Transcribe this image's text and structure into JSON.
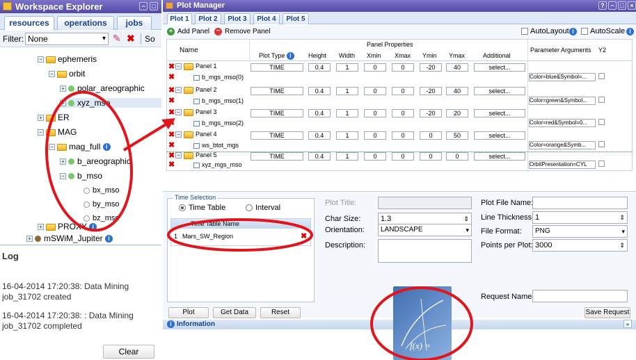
{
  "explorer": {
    "title": "Workspace Explorer",
    "tabs": [
      "resources",
      "operations",
      "jobs"
    ],
    "filter_label": "Filter:",
    "filter_value": "None",
    "so_text": "So",
    "tree": [
      {
        "label": "ephemeris",
        "kind": "folder"
      },
      {
        "label": "orbit",
        "kind": "folder"
      },
      {
        "label": "polar_areographic",
        "kind": "param"
      },
      {
        "label": "xyz_mso",
        "kind": "param"
      },
      {
        "label": "ER",
        "kind": "folder"
      },
      {
        "label": "MAG",
        "kind": "folder"
      },
      {
        "label": "mag_full",
        "kind": "folder"
      },
      {
        "label": "b_areographic",
        "kind": "param"
      },
      {
        "label": "b_mso",
        "kind": "param"
      },
      {
        "label": "bx_mso",
        "kind": "component"
      },
      {
        "label": "by_mso",
        "kind": "component"
      },
      {
        "label": "bz_mso",
        "kind": "component"
      },
      {
        "label": "PROXY",
        "kind": "folder"
      },
      {
        "label": "mSWiM_Jupiter",
        "kind": "dataset"
      }
    ]
  },
  "log": {
    "title": "Log",
    "entries": [
      "16-04-2014 17:20:38: Data Mining job_31702 created",
      "16-04-2014 17:20:38: : Data Mining job_31702 completed"
    ],
    "clear_label": "Clear"
  },
  "plot_manager": {
    "title": "Plot Manager",
    "tabs": [
      "Plot 1",
      "Plot 2",
      "Plot 3",
      "Plot 4",
      "Plot 5"
    ],
    "add_panel": "Add Panel",
    "remove_panel": "Remove Panel",
    "autolayout": "AutoLayout",
    "autoscale": "AutoScale",
    "headers": {
      "name": "Name",
      "panel_properties": "Panel Properties",
      "plot_type": "Plot Type",
      "height": "Height",
      "width": "Width",
      "xmin": "Xmin",
      "xmax": "Xmax",
      "ymin": "Ymin",
      "ymax": "Ymax",
      "additional": "Additional",
      "param_args": "Parameter Arguments",
      "y2": "Y2"
    },
    "panels": [
      {
        "name": "Panel 1",
        "plot_type": "TIME",
        "height": "0.4",
        "width": "1",
        "xmin": "0",
        "xmax": "0",
        "ymin": "-20",
        "ymax": "40",
        "additional": "select...",
        "param": "b_mgs_mso(0)",
        "args": "Color=blue&Symbol=..."
      },
      {
        "name": "Panel 2",
        "plot_type": "TIME",
        "height": "0.4",
        "width": "1",
        "xmin": "0",
        "xmax": "0",
        "ymin": "-20",
        "ymax": "40",
        "additional": "select...",
        "param": "b_mgs_mso(1)",
        "args": "Color=green&Symbol..."
      },
      {
        "name": "Panel 3",
        "plot_type": "TIME",
        "height": "0.4",
        "width": "1",
        "xmin": "0",
        "xmax": "0",
        "ymin": "-20",
        "ymax": "20",
        "additional": "select...",
        "param": "b_mgs_mso(2)",
        "args": "Color=red&Symbol=0..."
      },
      {
        "name": "Panel 4",
        "plot_type": "TIME",
        "height": "0.4",
        "width": "1",
        "xmin": "0",
        "xmax": "0",
        "ymin": "0",
        "ymax": "50",
        "additional": "select...",
        "param": "ws_btot_mgs",
        "args": "Color=orange&Symb..."
      },
      {
        "name": "Panel 5",
        "plot_type": "TIME",
        "height": "0.4",
        "width": "1",
        "xmin": "0",
        "xmax": "0",
        "ymin": "0",
        "ymax": "0",
        "additional": "select...",
        "param": "xyz_mgs_mso",
        "args": "OrbitPresentation=CYL"
      }
    ],
    "time_selection": {
      "title": "Time Selection",
      "time_table": "Time Table",
      "interval": "Interval",
      "table_header": "Time Table Name",
      "rows": [
        {
          "index": "1",
          "name": "Mars_SW_Region"
        }
      ]
    },
    "form": {
      "plot_title_label": "Plot Title:",
      "plot_title": "",
      "char_size_label": "Char Size:",
      "char_size": "1.3",
      "orientation_label": "Orientation:",
      "orientation": "LANDSCAPE",
      "description_label": "Description:",
      "description": "",
      "plot_file_name_label": "Plot File Name:",
      "plot_file_name": "",
      "line_thickness_label": "Line Thickness:",
      "line_thickness": "1",
      "file_format_label": "File Format:",
      "file_format": "PNG",
      "points_per_plot_label": "Points per Plot:",
      "points_per_plot": "3000",
      "request_name_label": "Request Name:",
      "request_name": ""
    },
    "buttons": {
      "plot": "Plot",
      "get_data": "Get Data",
      "reset": "Reset",
      "save_request": "Save Request"
    },
    "information_label": "Information",
    "fx_icon_text": "f(x) ="
  },
  "colors": {
    "annotation": "#e0161c",
    "title_bar": "#5a50b0",
    "accent": "#15428b"
  }
}
